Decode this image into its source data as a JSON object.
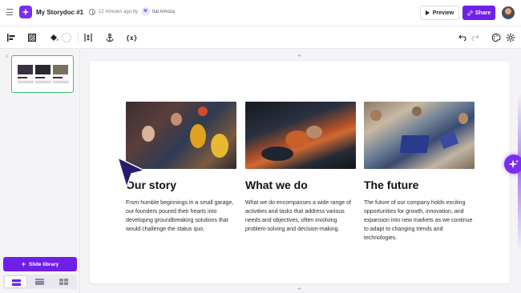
{
  "header": {
    "doc_title": "My Storydoc #1",
    "saved_text": "12 minutes ago by",
    "author_initial": "M",
    "author_name": "Itai Amoza",
    "preview_label": "Preview",
    "share_label": "Share"
  },
  "toolbar": {
    "variables_label": "{x}"
  },
  "sidebar": {
    "slide_number": "1",
    "slide_library_label": "Slide library"
  },
  "slide": {
    "columns": [
      {
        "heading": "Our story",
        "body": "From humble beginnings in a small garage, our founders poured their hearts into developing groundbreaking solutions that would challenge the status quo."
      },
      {
        "heading": "What we do",
        "body": "What we do encompasses a wide range of activities and tasks that address various needs and objectives, often involving problem-solving and decision-making."
      },
      {
        "heading": "The future",
        "body": "The future of our company holds exciting opportunities for growth, innovation, and expansion into new markets as we continue to adapt to changing trends and technologies."
      }
    ]
  },
  "colors": {
    "accent": "#6f1fe8",
    "thumbnail_border": "#35c46c"
  },
  "icons": [
    "menu-icon",
    "app-logo-icon",
    "clock-icon",
    "play-icon",
    "link-icon",
    "align-left-icon",
    "pattern-icon",
    "fill-color-icon",
    "spacing-icon",
    "anchor-icon",
    "undo-icon",
    "redo-icon",
    "theme-palette-icon",
    "settings-gear-icon",
    "sparkle-icon",
    "cursor-icon"
  ]
}
